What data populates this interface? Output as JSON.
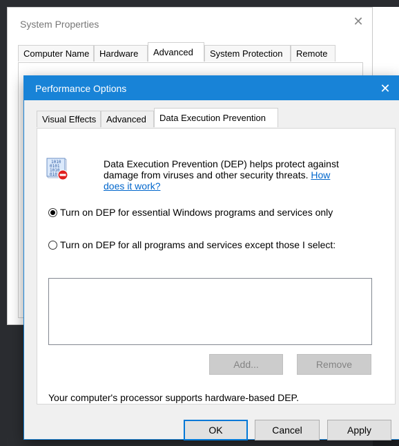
{
  "system_properties": {
    "title": "System Properties",
    "close_glyph": "✕",
    "tabs": [
      {
        "label": "Computer Name"
      },
      {
        "label": "Hardware"
      },
      {
        "label": "Advanced"
      },
      {
        "label": "System Protection"
      },
      {
        "label": "Remote"
      }
    ],
    "active_tab": "Advanced"
  },
  "performance_options": {
    "title": "Performance Options",
    "close_glyph": "✕",
    "accent_color": "#1883d7",
    "tabs": [
      {
        "label": "Visual Effects"
      },
      {
        "label": "Advanced"
      },
      {
        "label": "Data Execution Prevention"
      }
    ],
    "active_tab": "Data Execution Prevention",
    "dep_icon": "dep-shield-icon",
    "description_line1": "Data Execution Prevention (DEP) helps protect against",
    "description_line2": "damage from viruses and other security threats.",
    "link_text_1": "How",
    "link_text_2": "does it work?",
    "radio_essential": "Turn on DEP for essential Windows programs and services only",
    "radio_all": "Turn on DEP for all programs and services except those I select:",
    "selected_option": "essential",
    "add_button": "Add...",
    "remove_button": "Remove",
    "support_text": "Your computer's processor supports hardware-based DEP.",
    "ok_button": "OK",
    "cancel_button": "Cancel",
    "apply_button": "Apply"
  }
}
